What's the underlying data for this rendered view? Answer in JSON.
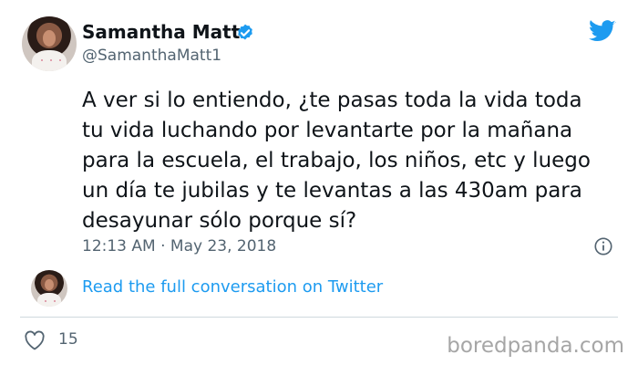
{
  "tweet": {
    "author_name": "Samantha Matt",
    "handle": "@SamanthaMatt1",
    "text": "A ver si lo entiendo, ¿te pasas toda la vida toda\ntu vida luchando por levantarte por la mañana\npara la escuela, el trabajo, los niños, etc y luego\nun día te jubilas y te levantas a las 430am para\ndesayunar sólo porque sí?",
    "timestamp": "12:13 AM · May 23, 2018",
    "conversation_link": "Read the full conversation on Twitter",
    "likes": "15"
  },
  "brand": {
    "accent": "#1d9bf0",
    "watermark": "boredpanda.com"
  },
  "icons": [
    "verified-badge-icon",
    "twitter-bird-icon",
    "info-icon",
    "heart-icon"
  ]
}
